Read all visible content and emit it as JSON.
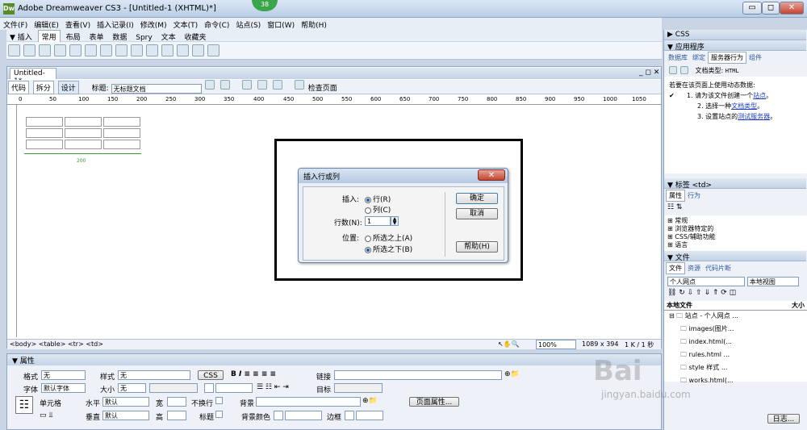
{
  "window": {
    "title": "Adobe Dreamweaver CS3 - [Untitled-1 (XHTML)*]",
    "app_icon": "Dw",
    "badge": "38",
    "min": "▭",
    "max": "◻",
    "close": "✕"
  },
  "menu": [
    "文件(F)",
    "编辑(E)",
    "查看(V)",
    "插入记录(I)",
    "修改(M)",
    "文本(T)",
    "命令(C)",
    "站点(S)",
    "窗口(W)",
    "帮助(H)"
  ],
  "insert_bar": {
    "label": "▼ 插入",
    "tabs": [
      "常用",
      "布局",
      "表单",
      "数据",
      "Spry",
      "文本",
      "收藏夹"
    ]
  },
  "document": {
    "tab": "Untitled-1*",
    "view_code": "代码",
    "view_split": "拆分",
    "view_design": "设计",
    "title_label": "标题:",
    "title_value": "无标题文档",
    "check_page": "检查页面",
    "ruler_ticks": [
      "0",
      "50",
      "100",
      "150",
      "200",
      "250",
      "300",
      "350",
      "400",
      "450",
      "500",
      "550",
      "600",
      "650",
      "700",
      "750",
      "800",
      "850",
      "900",
      "950",
      "1000",
      "1050"
    ],
    "table_width_label": "200"
  },
  "status": {
    "tags": "<body> <table> <tr> <td>",
    "zoom": "100%",
    "size": "1089 x 394",
    "download": "1 K / 1 秒"
  },
  "dialog": {
    "title": "插入行或列",
    "insert_label": "插入:",
    "row_option": "行(R)",
    "col_option": "列(C)",
    "count_label": "行数(N):",
    "count_value": "1",
    "position_label": "位置:",
    "above_option": "所选之上(A)",
    "below_option": "所选之下(B)",
    "ok": "确定",
    "cancel": "取消",
    "help": "帮助(H)"
  },
  "properties": {
    "header": "▼ 属性",
    "format_label": "格式",
    "format_value": "无",
    "style_label": "样式",
    "style_value": "无",
    "css_btn": "CSS",
    "link_label": "链接",
    "font_label": "字体",
    "font_value": "默认字体",
    "size_label": "大小",
    "size_value": "无",
    "target_label": "目标",
    "cell_label": "单元格",
    "horiz_label": "水平",
    "horiz_value": "默认",
    "width_label": "宽",
    "nowrap_label": "不换行",
    "bg_label": "背景",
    "page_props": "页面属性...",
    "vert_label": "垂直",
    "vert_value": "默认",
    "height_label": "高",
    "header_label": "标题",
    "bgcolor_label": "背景颜色",
    "border_label": "边框"
  },
  "right_panel": {
    "css_head": "▶ CSS",
    "app_head": "▼ 应用程序",
    "app_tabs": [
      "数据库",
      "绑定",
      "服务器行为",
      "组件"
    ],
    "doc_type_label": "文档类型:",
    "doc_type_value": "HTML",
    "instructions_title": "若要在该页面上使用动态数据:",
    "steps": [
      {
        "pre": "1. 请为该文件创建一个",
        "link": "站点",
        "post": "。"
      },
      {
        "pre": "2. 选择一种",
        "link": "文档类型",
        "post": "。"
      },
      {
        "pre": "3. 设置站点的",
        "link": "测试服务器",
        "post": "。"
      }
    ],
    "tag_head": "▼ 标签 <td>",
    "tag_tabs": [
      "属性",
      "行为"
    ],
    "tag_groups": [
      "常规",
      "浏览器特定的",
      "CSS/辅助功能",
      "语言"
    ],
    "files_head": "▼ 文件",
    "files_tabs": [
      "文件",
      "资源",
      "代码片断"
    ],
    "site_select": "个人网点",
    "view_select": "本地视图",
    "col_local": "本地文件",
    "col_size": "大小",
    "tree": [
      "站点 - 个人网点 ...",
      "images(图片...",
      "index.html(...",
      "rules.html ...",
      "style 样式 ...",
      "works.html(..."
    ],
    "log_btn": "日志..."
  },
  "watermark": {
    "main": "Bai",
    "sub": "jingyan.baidu.com"
  }
}
